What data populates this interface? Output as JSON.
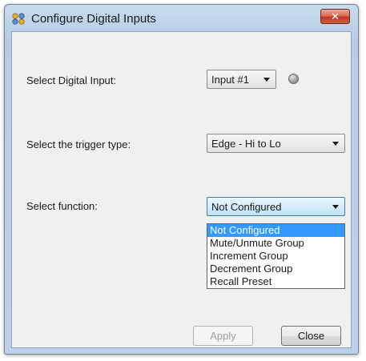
{
  "window": {
    "title": "Configure Digital Inputs",
    "close_glyph": "✕"
  },
  "digital_input": {
    "label": "Select Digital Input:",
    "selected": "Input #1",
    "indicator_state": "off"
  },
  "trigger": {
    "label": "Select the trigger type:",
    "selected": "Edge - Hi to Lo"
  },
  "function": {
    "label": "Select function:",
    "selected": "Not Configured",
    "dropdown_open": true,
    "options": [
      "Not Configured",
      "Mute/Unmute Group",
      "Increment Group",
      "Decrement Group",
      "Recall Preset"
    ],
    "highlighted_index": 0
  },
  "buttons": {
    "apply_label": "Apply",
    "apply_enabled": false,
    "close_label": "Close"
  },
  "icons": {
    "app": "app-icon",
    "close": "close-icon",
    "dropdown": "chevron-down-icon",
    "indicator": "status-led-icon"
  },
  "colors": {
    "selection": "#3399ff",
    "close_button": "#c7442a",
    "window_frame": "#bcd1e8"
  }
}
